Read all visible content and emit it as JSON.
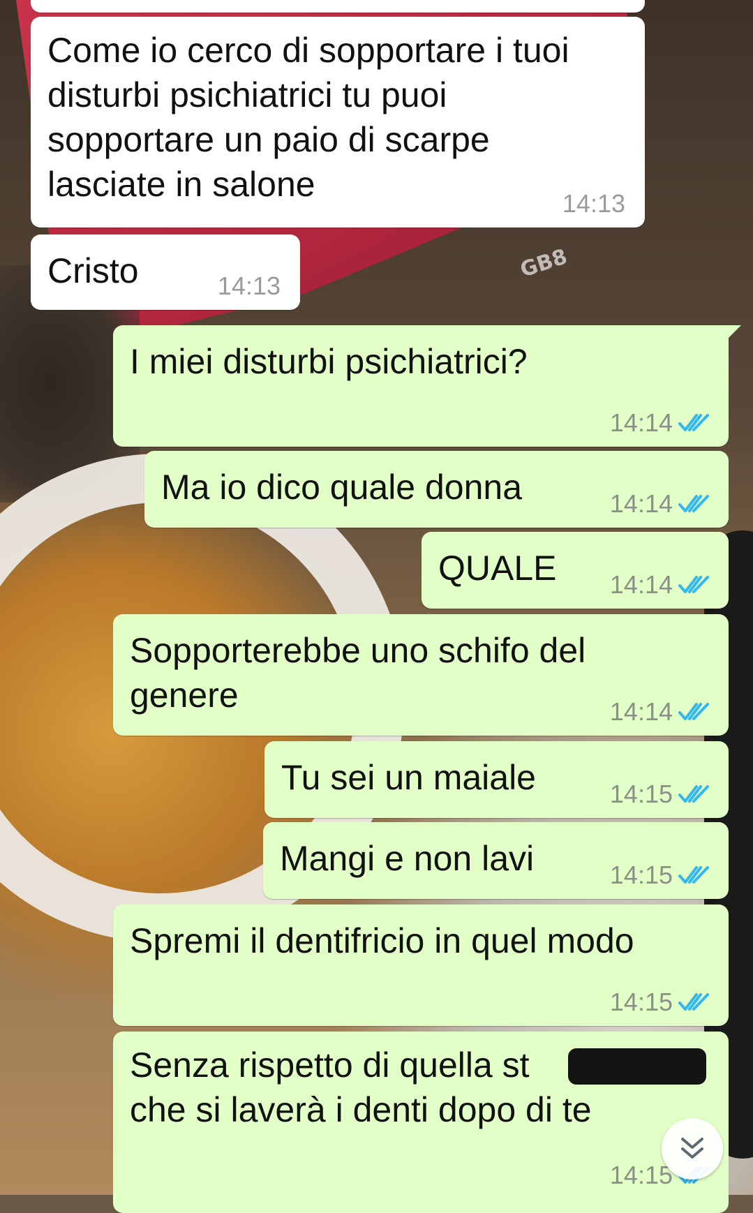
{
  "wallpaper_label": "GB8",
  "messages": [
    {
      "direction": "in",
      "text": "Come io cerco di sopportare i tuoi disturbi psichiatrici tu puoi sopportare un paio di scarpe lasciate in salone",
      "time": "14:13"
    },
    {
      "direction": "in",
      "text": "Cristo",
      "time": "14:13"
    },
    {
      "direction": "out",
      "text": "I miei disturbi psichiatrici?",
      "time": "14:14",
      "status": "read"
    },
    {
      "direction": "out",
      "text": "Ma io dico quale donna",
      "time": "14:14",
      "status": "read"
    },
    {
      "direction": "out",
      "text": "QUALE",
      "time": "14:14",
      "status": "read"
    },
    {
      "direction": "out",
      "text": "Sopporterebbe uno schifo del genere",
      "time": "14:14",
      "status": "read"
    },
    {
      "direction": "out",
      "text": "Tu sei un maiale",
      "time": "14:15",
      "status": "read"
    },
    {
      "direction": "out",
      "text": "Mangi e non lavi",
      "time": "14:15",
      "status": "read"
    },
    {
      "direction": "out",
      "text": "Spremi il dentifricio in quel modo",
      "time": "14:15",
      "status": "read"
    },
    {
      "direction": "out",
      "text": "Senza rispetto di quella st\nche si laverà i denti dopo di te",
      "time": "14:15",
      "status": "read",
      "redacted": true
    }
  ],
  "colors": {
    "incoming_bubble": "#ffffff",
    "outgoing_bubble": "#e2ffc7",
    "read_ticks": "#34b7f1",
    "timestamp": "#8a8f8a"
  },
  "icons": {
    "read_receipt": "double-check-icon",
    "scroll_down": "chevron-double-down-icon"
  }
}
